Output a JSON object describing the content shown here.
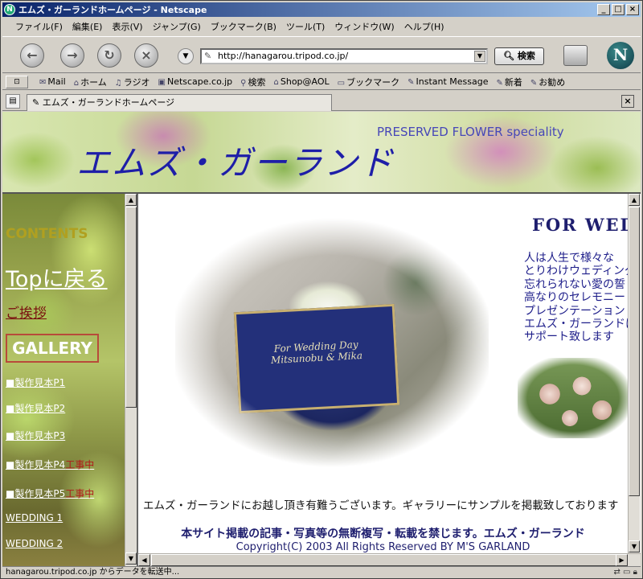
{
  "window": {
    "title": "エムズ・ガーランドホームページ - Netscape",
    "minimize": "_",
    "maximize": "□",
    "close": "×"
  },
  "menu": [
    "ファイル(F)",
    "編集(E)",
    "表示(V)",
    "ジャンプ(G)",
    "ブックマーク(B)",
    "ツール(T)",
    "ウィンドウ(W)",
    "ヘルプ(H)"
  ],
  "nav": {
    "back": "←",
    "forward": "→",
    "reload": "↻",
    "stop": "×",
    "url": "http://hanagarou.tripod.co.jp/",
    "search_label": "検索",
    "logo": "N"
  },
  "personal_toolbar": [
    "Mail",
    "ホーム",
    "ラジオ",
    "Netscape.co.jp",
    "検索",
    "Shop@AOL",
    "ブックマーク",
    "Instant Message",
    "新着",
    "お勧め"
  ],
  "tab": {
    "label": "エムズ・ガーランドホームページ",
    "close": "×"
  },
  "banner": {
    "subtitle": "PRESERVED FLOWER speciality",
    "title": "エムズ・ガーランド"
  },
  "sidebar": {
    "contents": "CONTENTS",
    "top": "Topに戻る",
    "greeting": "ご挨拶",
    "gallery": "GALLERY",
    "links": [
      {
        "label": "■製作見本P1",
        "note": ""
      },
      {
        "label": "■製作見本P2",
        "note": ""
      },
      {
        "label": "■製作見本P3",
        "note": ""
      },
      {
        "label": "■製作見本P4",
        "note": "工事中"
      },
      {
        "label": "■製作見本P5",
        "note": "工事中"
      },
      {
        "label": "WEDDING 1",
        "note": ""
      },
      {
        "label": "WEDDING 2",
        "note": ""
      }
    ]
  },
  "main": {
    "heading": "FOR WEDDING",
    "board_line1": "For Wedding Day",
    "board_line2": "Mitsunobu & Mika",
    "body_lines": [
      "人は人生で様々な",
      "とりわけウェディング",
      "忘れられない愛の誓",
      "高なりのセレモニー",
      "プレゼンテーション",
      "エムズ・ガーランドは",
      "サポート致します"
    ],
    "welcome": "エムズ・ガーランドにお越し頂き有難うございます。ギャラリーにサンプルを掲載致しております",
    "notice": "本サイト掲載の記事・写真等の無断複写・転載を禁じます。エムズ・ガーランド",
    "copyright": "Copyright(C) 2003 All Rights Reserved BY M'S GARLAND"
  },
  "status": {
    "text": "hanagarou.tripod.co.jp からデータを転送中..."
  }
}
